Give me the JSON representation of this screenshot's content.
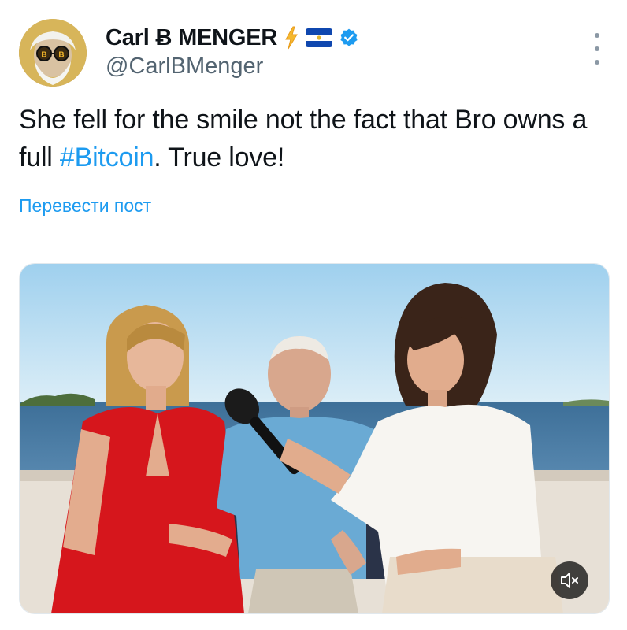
{
  "author": {
    "display_name": "Carl Ƀ MENGER",
    "handle": "@CarlBMenger",
    "badges": [
      "lightning-emoji",
      "el-salvador-flag",
      "verified-badge"
    ]
  },
  "avatar": {
    "initials_on_glasses": [
      "B",
      "B"
    ]
  },
  "post": {
    "text_before": "She fell for the smile not the fact that Bro owns a full ",
    "hashtag": "#Bitcoin",
    "text_after": ". True love!"
  },
  "translate_link": "Перевести пост",
  "media": {
    "type": "video",
    "mute_icon": "speaker-muted-icon"
  },
  "colors": {
    "accent": "#1d9bf0",
    "text": "#0f1419",
    "secondary": "#536471"
  }
}
